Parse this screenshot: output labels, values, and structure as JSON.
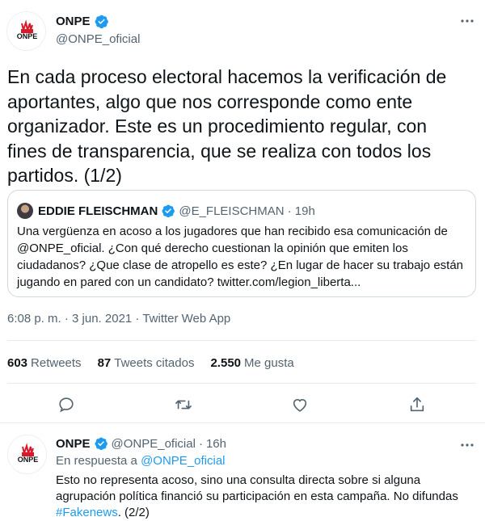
{
  "main_tweet": {
    "author_name": "ONPE",
    "author_handle": "@ONPE_oficial",
    "logo_text": "ONPE",
    "text": "En cada proceso electoral hacemos la verificación de\naportantes, algo que nos corresponde como ente\norganizador. Este es un procedimiento regular, con\nfines de transparencia, que se realiza con todos los\npartidos. (1/2)",
    "timestamp": "6:08 p. m. · 3 jun. 2021 · Twitter Web App",
    "stats": [
      {
        "count": "603",
        "label": "Retweets"
      },
      {
        "count": "87",
        "label": "Tweets citados"
      },
      {
        "count": "2.550",
        "label": "Me gusta"
      }
    ]
  },
  "quoted_tweet": {
    "author_name": "EDDIE FLEISCHMAN",
    "author_handle": "@E_FLEISCHMAN",
    "time": "· 19h",
    "text": "Una vergüenza en acoso a los jugadores que han recibido esa comunicación de\n@ONPE_oficial. ¿Con qué derecho cuestionan la opinión que emiten los\nciudadanos? ¿Que clase de atropello es este? ¿En lugar de hacer su trabajo están\njugando en pared con un candidato? twitter.com/legion_liberta..."
  },
  "reply_tweet": {
    "author_name": "ONPE",
    "author_handle": "@ONPE_oficial",
    "dot": "·",
    "time": "16h",
    "logo_text": "ONPE",
    "replying_prefix": "En respuesta a",
    "replying_to": "@ONPE_oficial",
    "text": "Esto no representa acoso, sino una consulta directa sobre si alguna agrupación política financió su participación en esta campaña. No difundas",
    "hashtag": "#Fakenews",
    "suffix": ". (2/2)"
  },
  "colors": {
    "accent": "#1d9bf0",
    "secondary_text": "#536471",
    "primary_text": "#0f1419",
    "border": "#cfd9de",
    "logo_red": "#d7192b"
  },
  "icons": [
    "verified-badge-icon",
    "more-options-icon",
    "reply-icon",
    "retweet-icon",
    "like-icon",
    "share-icon"
  ]
}
